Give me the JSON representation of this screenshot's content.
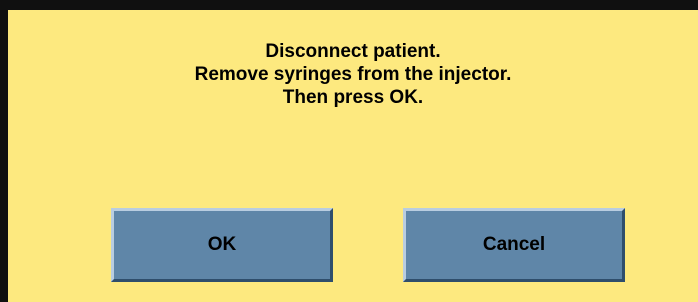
{
  "dialog": {
    "message_lines": [
      "Disconnect patient.",
      "Remove syringes from the injector.",
      "Then press OK."
    ],
    "ok_label": "OK",
    "cancel_label": "Cancel"
  },
  "colors": {
    "background": "#fde97f",
    "button": "#5f86a8",
    "border": "#101010"
  }
}
